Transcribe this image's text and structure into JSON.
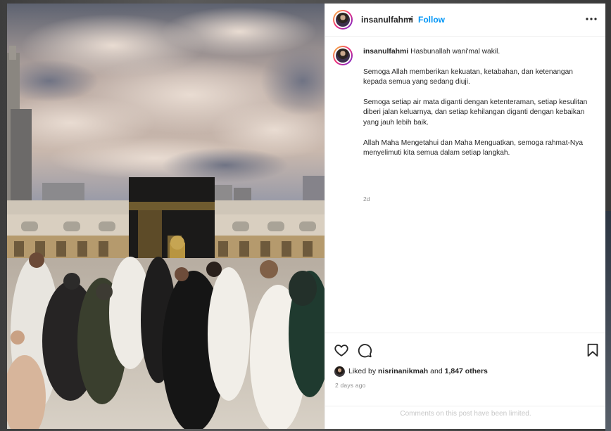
{
  "post": {
    "username": "insanulfahmi",
    "separator": "•",
    "follow_label": "Follow",
    "more_icon": "more-options-icon",
    "caption": {
      "username": "insanulfahmi",
      "first_line": "Hasbunallah wani'mal wakil.",
      "paragraphs": [
        "Semoga Allah memberikan kekuatan, ketabahan, dan ketenangan kepada semua yang sedang diuji.",
        "Semoga setiap air mata diganti dengan ketenteraman, setiap kesulitan diberi jalan keluarnya, dan setiap kehilangan diganti dengan kebaikan yang jauh lebih baik.",
        "Allah Maha Mengetahui dan Maha Menguatkan, semoga rahmat-Nya menyelimuti kita semua dalam setiap langkah."
      ],
      "time": "2d"
    },
    "actions": {
      "like_icon": "heart-icon",
      "comment_icon": "comment-icon",
      "save_icon": "bookmark-icon"
    },
    "likes": {
      "prefix": "Liked by",
      "user": "nisrinanikmah",
      "connector": "and",
      "others": "1,847 others"
    },
    "posted_ago": "2 days ago",
    "comments_notice": "Comments on this post have been limited.",
    "colors": {
      "follow": "#0095f6",
      "muted": "#8e8e8e",
      "text": "#262626"
    }
  }
}
